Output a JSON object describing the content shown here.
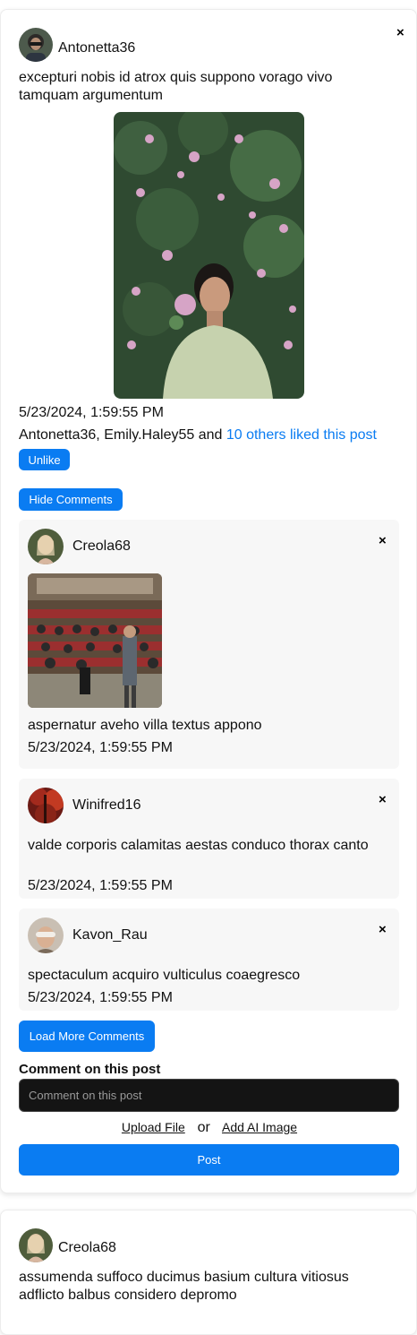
{
  "post1": {
    "author": "Antonetta36",
    "text": "excepturi nobis id atrox quis suppono vorago vivo tamquam argumentum",
    "timestamp": "5/23/2024, 1:59:55 PM",
    "likes_prefix": "Antonetta36, Emily.Haley55 and ",
    "likes_link": "10 others liked this post",
    "unlike_label": "Unlike",
    "hide_comments_label": "Hide Comments",
    "close_icon": "×",
    "comments": [
      {
        "author": "Creola68",
        "text": "aspernatur aveho villa textus appono",
        "timestamp": "5/23/2024, 1:59:55 PM"
      },
      {
        "author": "Winifred16",
        "text": "valde corporis calamitas aestas conduco thorax canto",
        "timestamp": "5/23/2024, 1:59:55 PM"
      },
      {
        "author": "Kavon_Rau",
        "text": "spectaculum acquiro vulticulus coaegresco",
        "timestamp": "5/23/2024, 1:59:55 PM"
      }
    ],
    "load_more_label": "Load More Comments",
    "comment_heading": "Comment on this post",
    "comment_placeholder": "Comment on this post",
    "upload_label": "Upload File",
    "or_label": "or",
    "ai_image_label": "Add AI Image",
    "post_label": "Post"
  },
  "post2": {
    "author": "Creola68",
    "text": "assumenda suffoco ducimus basium cultura vitiosus adflicto balbus considero depromo"
  },
  "colors": {
    "accent": "#0a7cf2",
    "comment_bg": "#f7f7f7",
    "input_bg": "#141414"
  }
}
